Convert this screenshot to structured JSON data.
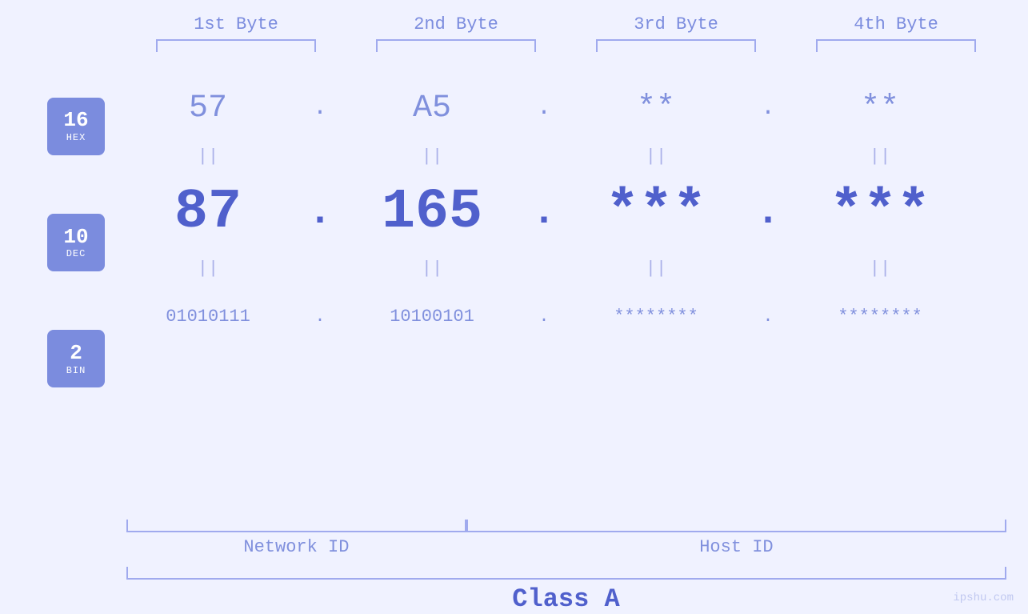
{
  "header": {
    "byte1": "1st Byte",
    "byte2": "2nd Byte",
    "byte3": "3rd Byte",
    "byte4": "4th Byte"
  },
  "badges": [
    {
      "num": "16",
      "sub": "HEX"
    },
    {
      "num": "10",
      "sub": "DEC"
    },
    {
      "num": "2",
      "sub": "BIN"
    }
  ],
  "hex": {
    "b1": "57",
    "b2": "A5",
    "b3": "**",
    "b4": "**",
    "dot": "."
  },
  "dec": {
    "b1": "87",
    "b2": "165",
    "b3": "***",
    "b4": "***",
    "dot": "."
  },
  "bin": {
    "b1": "01010111",
    "b2": "10100101",
    "b3": "********",
    "b4": "********",
    "dot": "."
  },
  "labels": {
    "network_id": "Network ID",
    "host_id": "Host ID",
    "class": "Class A"
  },
  "watermark": "ipshu.com"
}
